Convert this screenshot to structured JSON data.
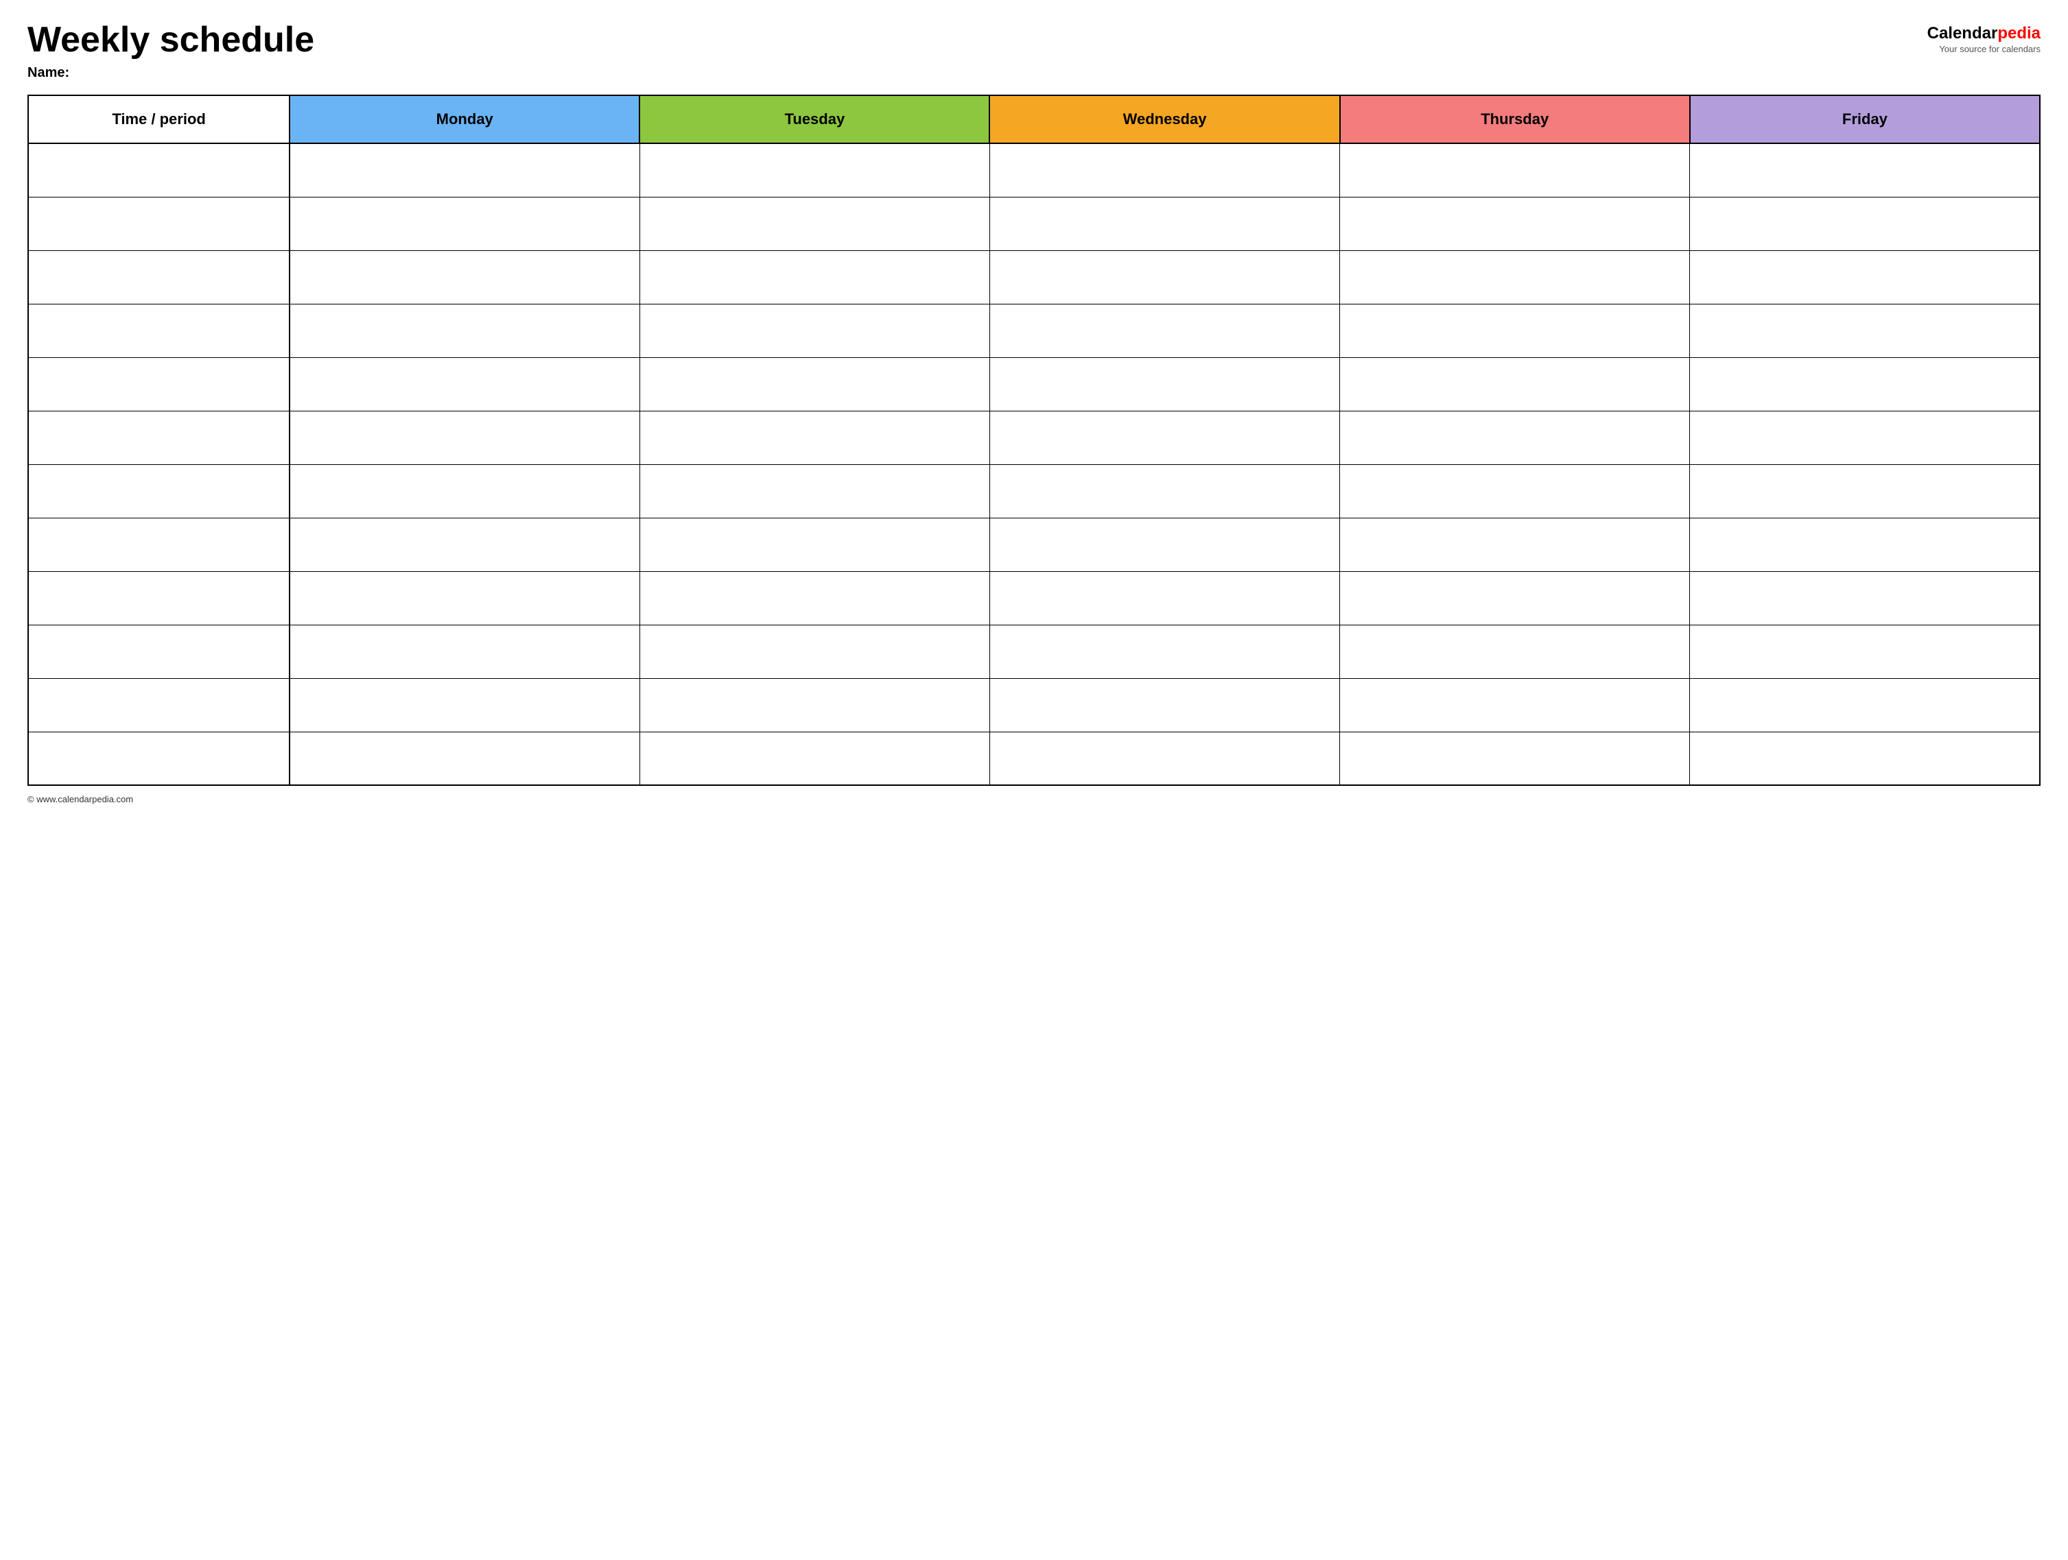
{
  "header": {
    "title": "Weekly schedule",
    "name_label": "Name:",
    "logo_calendar": "Calendar",
    "logo_pedia": "pedia",
    "logo_tagline": "Your source for calendars"
  },
  "table": {
    "columns": [
      {
        "id": "time",
        "label": "Time / period",
        "color": "#ffffff"
      },
      {
        "id": "monday",
        "label": "Monday",
        "color": "#6ab4f5"
      },
      {
        "id": "tuesday",
        "label": "Tuesday",
        "color": "#8dc63f"
      },
      {
        "id": "wednesday",
        "label": "Wednesday",
        "color": "#f5a623"
      },
      {
        "id": "thursday",
        "label": "Thursday",
        "color": "#f47c7c"
      },
      {
        "id": "friday",
        "label": "Friday",
        "color": "#b39ddb"
      }
    ],
    "row_count": 12
  },
  "footer": {
    "url": "© www.calendarpedia.com"
  }
}
